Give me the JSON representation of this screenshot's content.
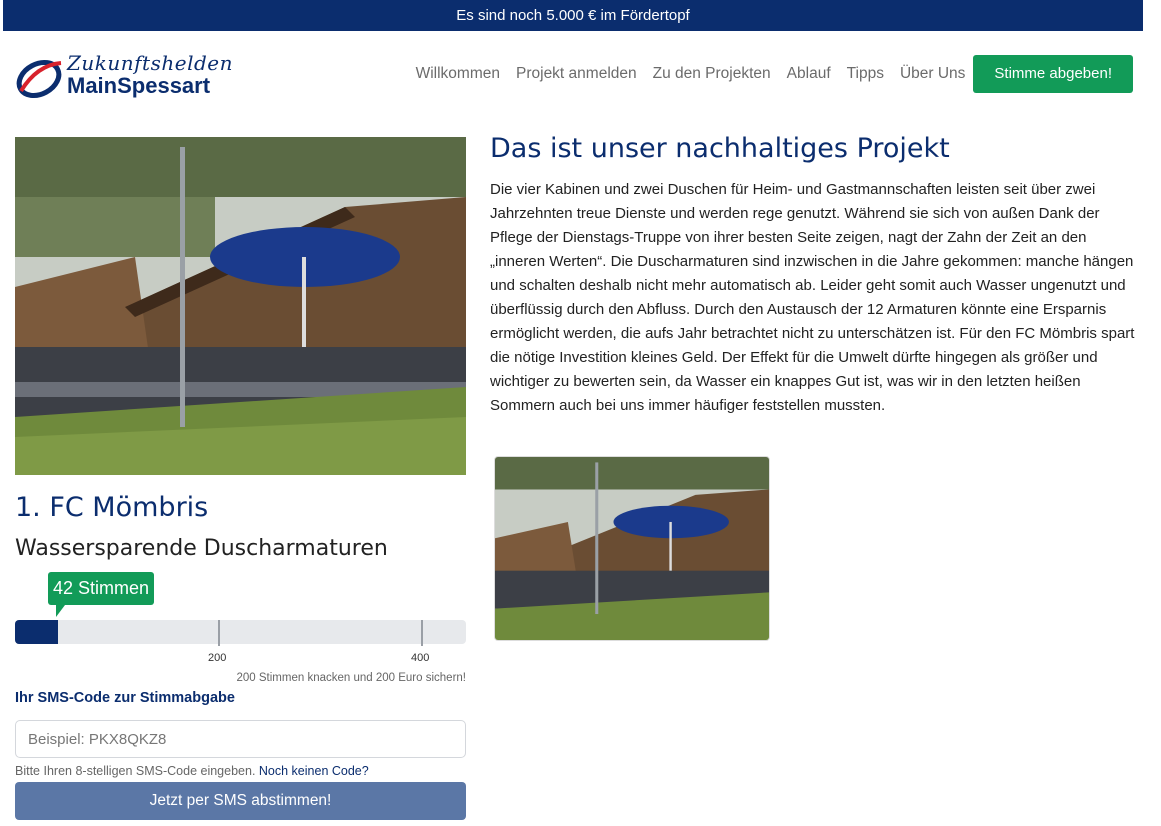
{
  "banner": {
    "text": "Es sind noch 5.000 € im Fördertopf"
  },
  "logo": {
    "line1": "Zukunftshelden",
    "line2": "MainSpessart"
  },
  "nav": {
    "items": [
      "Willkommen",
      "Projekt anmelden",
      "Zu den Projekten",
      "Ablauf",
      "Tipps",
      "Über Uns"
    ],
    "vote_button": "Stimme abgeben!"
  },
  "project": {
    "organization": "1. FC Mömbris",
    "title": "Wassersparende Duscharmaturen",
    "votes_label": "42 Stimmen",
    "votes": 42,
    "progress_max": 445,
    "ticks": [
      "200",
      "400"
    ],
    "goal_hint": "200 Stimmen knacken und 200 Euro sichern!"
  },
  "sms": {
    "label": "Ihr SMS-Code zur Stimmabgabe",
    "placeholder": "Beispiel: PKX8QKZ8",
    "help_text": "Bitte Ihren 8-stelligen SMS-Code eingeben.",
    "help_link": "Noch keinen Code?",
    "button": "Jetzt per SMS abstimmen!"
  },
  "description": {
    "heading": "Das ist unser nachhaltiges Projekt",
    "text": "Die vier Kabinen und zwei Duschen für Heim- und Gastmannschaften leisten seit über zwei Jahrzehnten treue Dienste und werden rege genutzt. Während sie sich von außen Dank der Pflege der Dienstags-Truppe von ihrer besten Seite zeigen, nagt der Zahn der Zeit an den „inneren Werten“.  Die Duscharmaturen sind inzwischen in die Jahre gekommen: manche hängen und schalten deshalb nicht mehr automatisch ab. Leider geht somit auch Wasser ungenutzt und überflüssig durch den Abfluss. Durch den Austausch der 12 Armaturen könnte eine Ersparnis ermöglicht werden, die aufs Jahr betrachtet nicht zu unterschätzen ist.  Für den FC Mömbris spart die nötige Investition kleines Geld. Der Effekt für die Umwelt dürfte hingegen als größer und wichtiger zu bewerten sein, da Wasser ein knappes Gut ist, was wir in den letzten heißen Sommern auch bei uns immer häufiger feststellen mussten."
  },
  "colors": {
    "brand": "#0b2d6e",
    "accent": "#129b58",
    "sms_button": "#5b77a6"
  }
}
